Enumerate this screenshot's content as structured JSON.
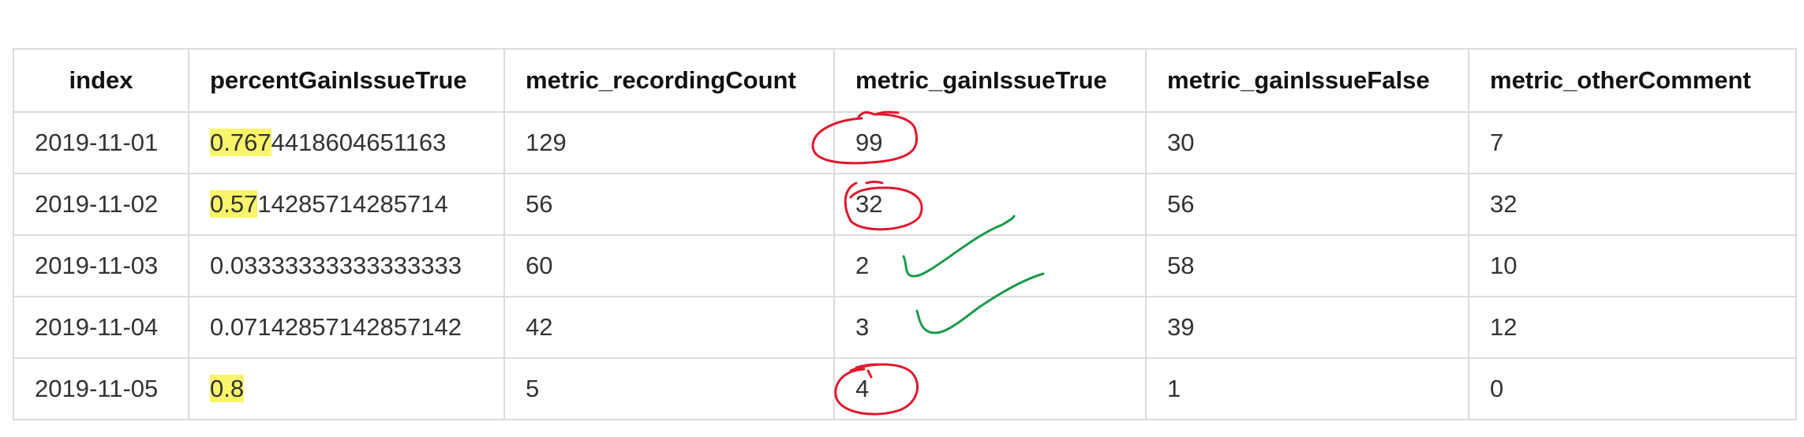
{
  "table": {
    "columns": [
      "index",
      "percentGainIssueTrue",
      "metric_recordingCount",
      "metric_gainIssueTrue",
      "metric_gainIssueFalse",
      "metric_otherComment"
    ],
    "rows": [
      {
        "index": "2019-11-01",
        "pct_hl": "0.767",
        "pct_rest": "4418604651163",
        "count": "129",
        "gain_true": "99",
        "gain_false": "30",
        "other": "7"
      },
      {
        "index": "2019-11-02",
        "pct_hl": "0.57",
        "pct_rest": "14285714285714",
        "count": "56",
        "gain_true": "32",
        "gain_false": "56",
        "other": "32"
      },
      {
        "index": "2019-11-03",
        "pct_hl": "",
        "pct_rest": "0.03333333333333333",
        "count": "60",
        "gain_true": "2",
        "gain_false": "58",
        "other": "10"
      },
      {
        "index": "2019-11-04",
        "pct_hl": "",
        "pct_rest": "0.07142857142857142",
        "count": "42",
        "gain_true": "3",
        "gain_false": "39",
        "other": "12"
      },
      {
        "index": "2019-11-05",
        "pct_hl": "0.8",
        "pct_rest": "",
        "count": "5",
        "gain_true": "4",
        "gain_false": "1",
        "other": "0"
      }
    ]
  },
  "annotations": {
    "highlight_color": "#f8f56b",
    "circle_color": "#e0182d",
    "check_color": "#1a9a4a",
    "circled_cells": [
      "99",
      "32",
      "4"
    ],
    "checked_cells": [
      "2",
      "3"
    ]
  }
}
